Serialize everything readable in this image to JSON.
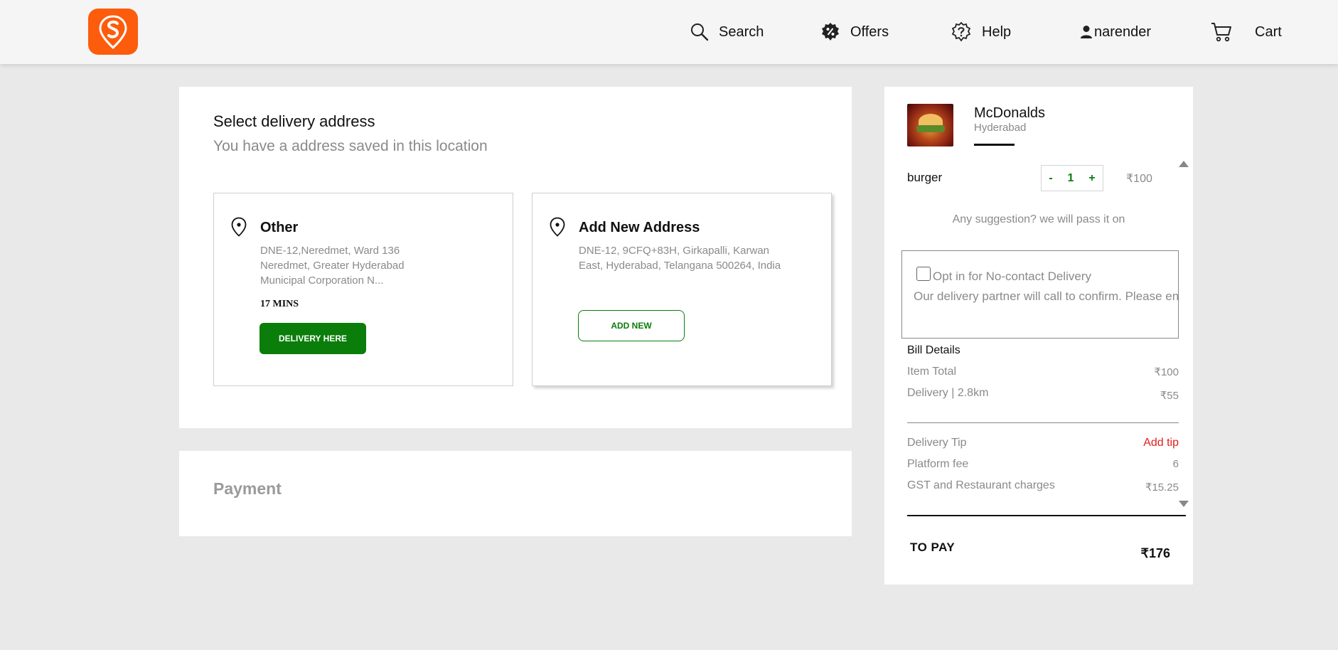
{
  "header": {
    "logo_icon": "swiggy-logo-icon",
    "brand_color": "#fc5c0c",
    "nav": {
      "search": "Search",
      "offers": "Offers",
      "help": "Help",
      "user": "narender",
      "cart": "Cart"
    }
  },
  "address": {
    "title": "Select delivery address",
    "subtitle": "You have a address saved in this location",
    "saved": {
      "heading": "Other",
      "text": "DNE-12,Neredmet, Ward 136 Neredmet, Greater Hyderabad Municipal Corporation N...",
      "eta": "17 MINS",
      "button": "DELIVERY HERE"
    },
    "new": {
      "heading": "Add New Address",
      "text": "DNE-12, 9CFQ+83H, Girkapalli, Karwan East, Hyderabad, Telangana 500264, India",
      "button": "ADD NEW"
    }
  },
  "payment": {
    "title": "Payment"
  },
  "cart": {
    "restaurant": {
      "name": "McDonalds",
      "city": "Hyderabad"
    },
    "item": {
      "name": "burger",
      "minus": "-",
      "qty": "1",
      "plus": "+",
      "price": "₹100"
    },
    "suggestion": "Any suggestion? we will pass it on",
    "no_contact": {
      "title": "Opt in for No-contact Delivery",
      "text": "Our delivery partner will call to confirm. Please en"
    },
    "bill": {
      "title": "Bill Details",
      "item_total_label": "Item Total",
      "item_total_value": "₹100",
      "delivery_label": "Delivery | 2.8km",
      "delivery_value": "₹55",
      "tip_label": "Delivery Tip",
      "tip_action": "Add tip",
      "platform_label": "Platform fee",
      "platform_value": "6",
      "gst_label": "GST and Restaurant charges",
      "gst_value": "₹15.25"
    },
    "to_pay_label": "TO PAY",
    "to_pay_value": "₹176"
  },
  "colors": {
    "accent_green": "#0a7d0a",
    "tip_red": "#e41c1c",
    "background": "#e9e9e9"
  }
}
